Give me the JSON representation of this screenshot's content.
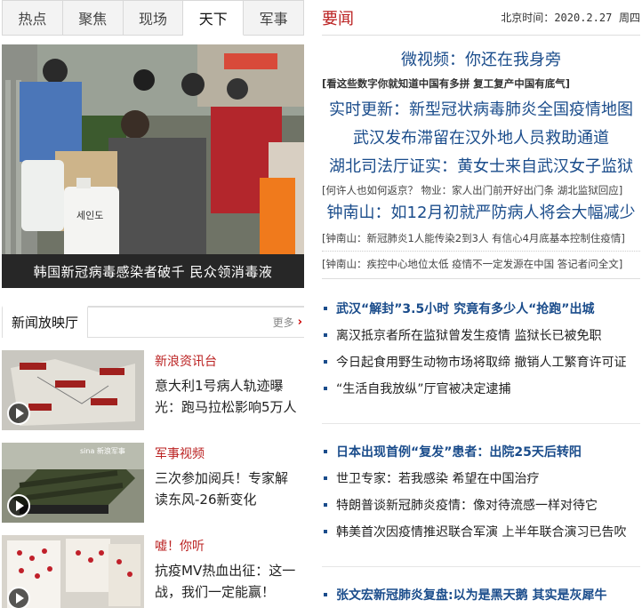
{
  "tabs": [
    "热点",
    "聚焦",
    "现场",
    "天下",
    "军事"
  ],
  "photo": {
    "caption": "韩国新冠病毒感染者破千 民众领消毒液",
    "jug_label": "세인도"
  },
  "video_section": {
    "title": "新闻放映厅",
    "more": "更多"
  },
  "videos": [
    {
      "source": "新浪资讯台",
      "title": "意大利1号病人轨迹曝光：跑马拉松影响5万人"
    },
    {
      "source": "军事视频",
      "title": "三次参加阅兵！专家解读东风-26新变化",
      "watermark": "sina 新浪军事"
    },
    {
      "source": "嘘！你听",
      "title": "抗疫MV热血出征：这一战，我们一定能赢！"
    }
  ],
  "news": {
    "title": "要闻",
    "date_label": "北京时间：",
    "date_value": "2020.2.27",
    "weekday": "周四",
    "headlines": [
      "微视频：你还在我身旁",
      "实时更新：新型冠状病毒肺炎全国疫情地图",
      "武汉发布滞留在汉外地人员救助通道",
      "湖北司法厅证实：黄女士来自武汉女子监狱",
      "钟南山：如12月初就严防病人将会大幅减少"
    ],
    "brackets": {
      "b1": "[看这些数字你就知道中国有多拼 复工复产中国有底气]",
      "b2": "[何许人也如何返京？ 物业：家人出门前开好出门条 湖北监狱回应]",
      "b3": "[钟南山：新冠肺炎1人能传染2到3人 有信心4月底基本控制住疫情]",
      "b4": "[钟南山：疾控中心地位太低 疫情不一定发源在中国 答记者问全文]"
    },
    "list1": [
      "武汉“解封”3.5小时 究竟有多少人“抢跑”出城",
      "离汉抵京者所在监狱曾发生疫情 监狱长已被免职",
      "今日起食用野生动物市场将取缔 撤销人工繁育许可证",
      "“生活自我放纵”厅官被决定逮捕"
    ],
    "list2": [
      "日本出现首例“复发”患者：出院25天后转阳",
      "世卫专家：若我感染 希望在中国治疗",
      "特朗普谈新冠肺炎疫情：像对待流感一样对待它",
      "韩美首次因疫情推迟联合军演 上半年联合演习已告吹"
    ],
    "list3": [
      "张文宏新冠肺炎复盘:以为是黑天鹅 其实是灰犀牛"
    ]
  },
  "colors": {
    "accent": "#b22222",
    "link": "#1a4c8b"
  }
}
